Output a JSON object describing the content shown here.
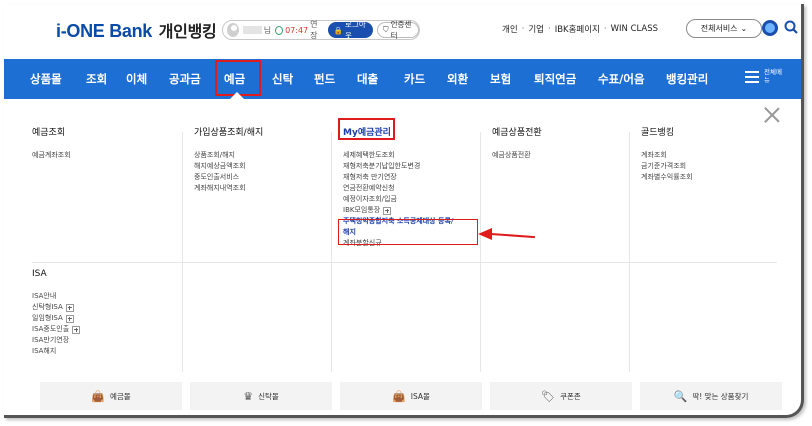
{
  "header": {
    "logo_brand": "i-ONE Bank",
    "logo_suffix": "개인뱅킹",
    "user_suffix": "님",
    "time": "07:47",
    "extend_label": "연장",
    "logout_label": "로그아웃",
    "cert_label": "인증센터",
    "links": [
      "개인",
      "기업",
      "IBK홈페이지",
      "WIN CLASS"
    ],
    "all_services_label": "전체서비스"
  },
  "nav": {
    "items": [
      "상품몰",
      "조회",
      "이체",
      "공과금",
      "예금",
      "신탁",
      "펀드",
      "대출",
      "카드",
      "외환",
      "보험",
      "퇴직연금",
      "수표/어음",
      "뱅킹관리"
    ],
    "active": "예금",
    "menu_label": "전체메뉴"
  },
  "menu": {
    "columns": [
      {
        "title": "예금조회",
        "items": [
          "예금계좌조회"
        ]
      },
      {
        "title": "가입상품조회/해지",
        "items": [
          "상품조회/해지",
          "해지예상금액조회",
          "중도인출서비스",
          "계좌해지내역조회"
        ]
      },
      {
        "title": "My예금관리",
        "items": [
          "세제혜택한도조회",
          "재형저축분기납입한도변경",
          "재형저축 만기연장",
          "연금전환예약신청",
          "예정이자조회/입금",
          "IBK모임통장",
          "주택청약종합저축 소득공제대상 등록/",
          "해지",
          "계좌분할신규"
        ]
      },
      {
        "title": "예금상품전환",
        "items": [
          "예금상품전환"
        ]
      },
      {
        "title": "골드뱅킹",
        "items": [
          "계좌조회",
          "금기준가격조회",
          "계좌별수익률조회"
        ]
      }
    ],
    "isa": {
      "title": "ISA",
      "items": [
        "ISA안내",
        "신탁형ISA",
        "일임형ISA",
        "ISA중도인출",
        "ISA만기연장",
        "ISA해지"
      ]
    }
  },
  "quick": {
    "buttons": [
      "예금몰",
      "신탁몰",
      "ISA몰",
      "쿠폰존",
      "딱! 맞는 상품찾기"
    ]
  },
  "colors": {
    "nav_bg": "#1e6fd3",
    "highlight": "#e01b1b",
    "brand": "#0a4aa8"
  }
}
